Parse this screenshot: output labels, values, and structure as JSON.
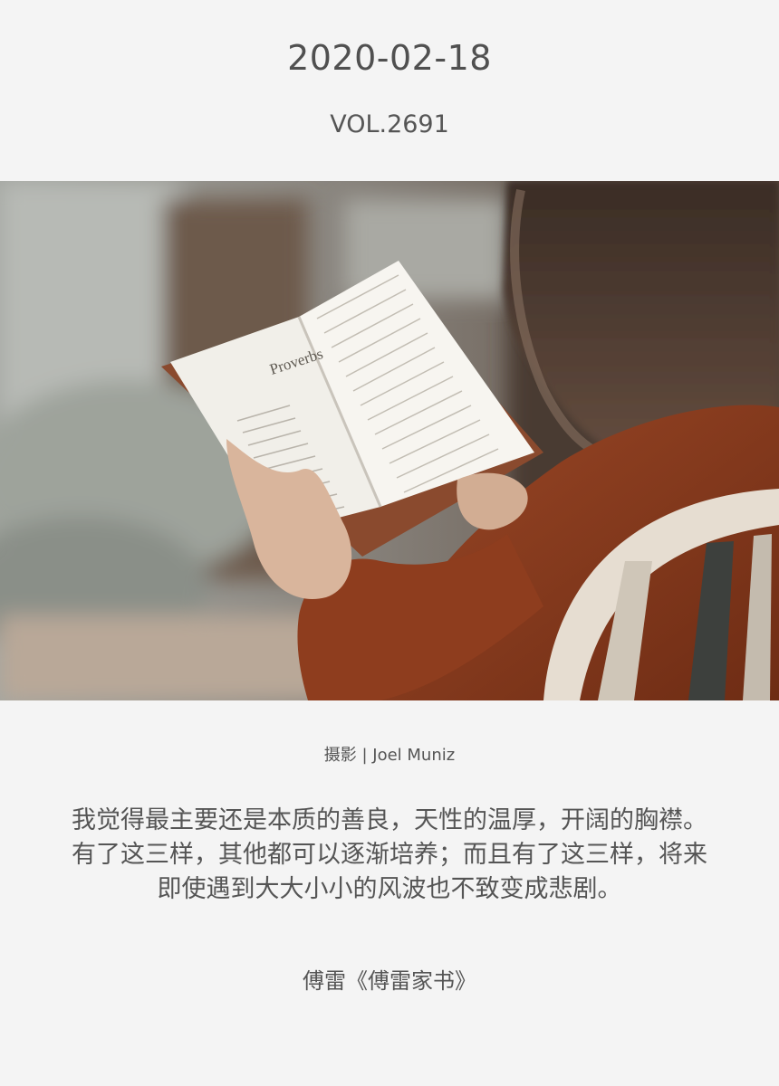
{
  "header": {
    "date": "2020-02-18",
    "volume": "VOL.2691"
  },
  "photo": {
    "book_heading": "Proverbs"
  },
  "credit": {
    "text": "摄影 | Joel Muniz"
  },
  "quote": {
    "lines": [
      "我觉得最主要还是本质的善良，天性的温厚，开阔的胸襟。",
      "有了这三样，其他都可以逐渐培养；而且有了这三样，将来",
      "即使遇到大大小小的风波也不致变成悲剧。"
    ]
  },
  "source": {
    "text": "傅雷《傅雷家书》"
  }
}
